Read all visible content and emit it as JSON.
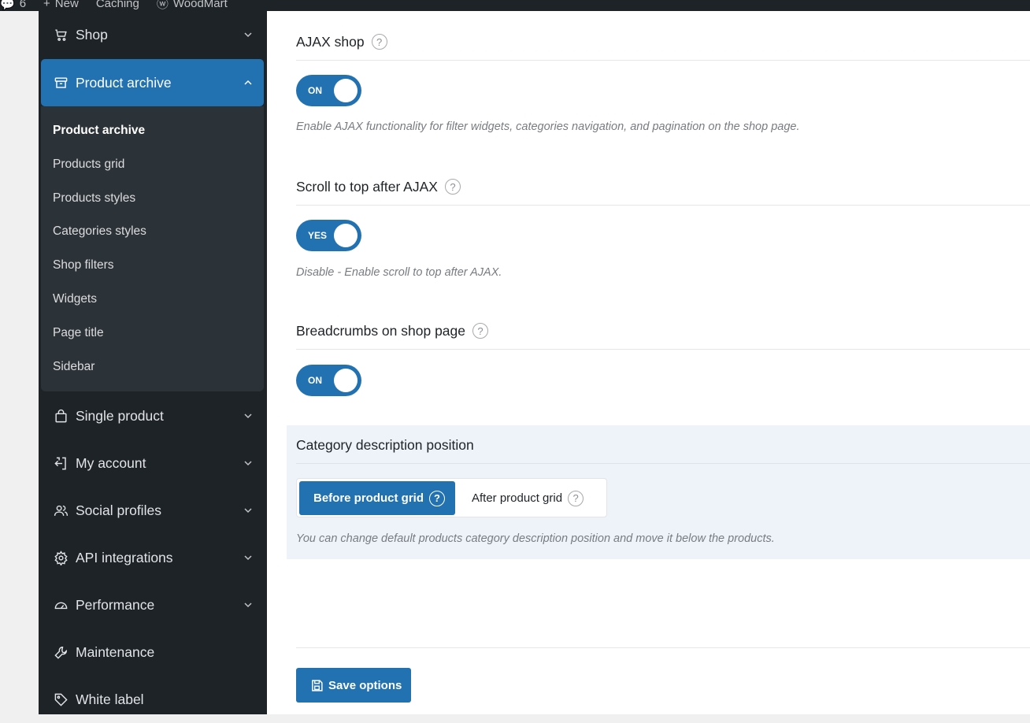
{
  "adminbar": {
    "items": [
      "6",
      "New",
      "Caching",
      "WoodMart"
    ]
  },
  "sidebar": {
    "top_item": {
      "label": "Shop",
      "icon": "cart-icon"
    },
    "active_item": {
      "label": "Product archive",
      "icon": "archive-box-icon"
    },
    "submenu": [
      "Product archive",
      "Products grid",
      "Products styles",
      "Categories styles",
      "Shop filters",
      "Widgets",
      "Page title",
      "Sidebar"
    ],
    "items": [
      {
        "label": "Single product",
        "icon": "shopping-bag-icon"
      },
      {
        "label": "My account",
        "icon": "login-icon"
      },
      {
        "label": "Social profiles",
        "icon": "users-icon"
      },
      {
        "label": "API integrations",
        "icon": "gear-icon"
      },
      {
        "label": "Performance",
        "icon": "gauge-icon"
      },
      {
        "label": "Maintenance",
        "icon": "wrench-icon"
      },
      {
        "label": "White label",
        "icon": "tag-icon"
      }
    ]
  },
  "fields": {
    "ajax_shop": {
      "title": "AJAX shop",
      "toggle": "ON",
      "description": "Enable AJAX functionality for filter widgets, categories navigation, and pagination on the shop page."
    },
    "scroll_top": {
      "title": "Scroll to top after AJAX",
      "toggle": "YES",
      "description": "Disable - Enable scroll to top after AJAX."
    },
    "breadcrumbs": {
      "title": "Breadcrumbs on shop page",
      "toggle": "ON"
    },
    "category_desc": {
      "title": "Category description position",
      "options": [
        "Before product grid",
        "After product grid"
      ],
      "selected": "Before product grid",
      "description": "You can change default products category description position and move it below the products."
    }
  },
  "help_glyph": "?",
  "save_label": "Save options",
  "colors": {
    "accent": "#2271b1",
    "sidebar_bg": "#1d2327",
    "submenu_bg": "#2c3338",
    "highlight_bg": "#eef3fa"
  }
}
